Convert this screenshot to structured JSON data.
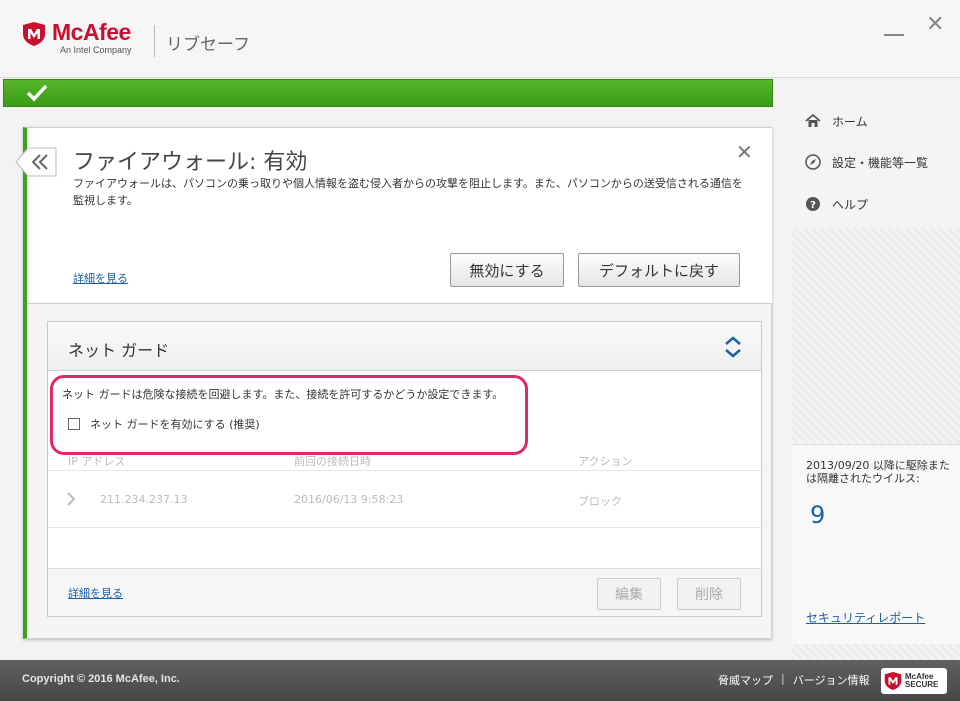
{
  "app": {
    "brand": "McAfee",
    "brand_sub": "An Intel Company",
    "product_name": "リブセーフ",
    "status": "protected"
  },
  "sidebar": {
    "items": [
      {
        "label": "ホーム",
        "icon": "home-icon"
      },
      {
        "label": "設定・機能等一覧",
        "icon": "compass-icon"
      },
      {
        "label": "ヘルプ",
        "icon": "help-icon"
      }
    ],
    "virus_label": "2013/09/20 以降に駆除または隔離されたウイルス:",
    "virus_count": "9",
    "report_link": "セキュリティレポート"
  },
  "panel": {
    "title": "ファイアウォール: 有効",
    "description": "ファイアウォールは、パソコンの乗っ取りや個人情報を盗む侵入者からの攻撃を阻止します。また、パソコンからの送受信される通信を監視します。",
    "details_link": "詳細を見る",
    "disable_button": "無効にする",
    "default_button": "デフォルトに戻す"
  },
  "netguard": {
    "title": "ネット ガード",
    "description": "ネット ガードは危険な接続を回避します。また、接続を許可するかどうか設定できます。",
    "checkbox_label": "ネット ガードを有効にする (推奨)",
    "checkbox_checked": false,
    "columns": [
      "IP アドレス",
      "前回の接続日時",
      "アクション"
    ],
    "rows": [
      {
        "ip": "211.234.237.13",
        "date": "2016/06/13 9:58:23",
        "action": "ブロック"
      }
    ],
    "details_link": "詳細を見る",
    "edit_button": "編集",
    "delete_button": "削除"
  },
  "footer": {
    "copyright": "Copyright © 2016 McAfee, Inc.",
    "threat_map": "脅威マップ",
    "separator": "|",
    "version_info": "バージョン情報",
    "badge_line1": "McAfee",
    "badge_line2": "SECURE"
  },
  "colors": {
    "brand_red": "#c8102e",
    "status_green": "#3ca418",
    "highlight": "#e0296b",
    "link_blue": "#1d5fa5"
  }
}
